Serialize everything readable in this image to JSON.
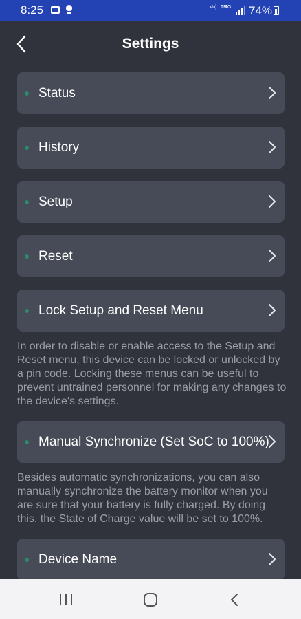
{
  "status_bar": {
    "time": "8:25",
    "volte": "Vo) LTE",
    "network": "4G",
    "battery_percent": "74%"
  },
  "header": {
    "title": "Settings"
  },
  "menu": {
    "items": [
      {
        "label": "Status"
      },
      {
        "label": "History"
      },
      {
        "label": "Setup"
      },
      {
        "label": "Reset"
      },
      {
        "label": "Lock Setup and Reset Menu"
      },
      {
        "label": "Manual Synchronize (Set SoC to 100%)"
      },
      {
        "label": "Device Name"
      }
    ]
  },
  "descriptions": {
    "lock": "In order to disable or enable access to the Setup and Reset menu, this device can be locked or unlocked by a pin code. Locking these menus can be useful to prevent untrained personnel for making any changes to the device's settings.",
    "sync": "Besides automatic synchronizations, you can also manually synchronize the battery monitor when you are sure that your battery is fully charged. By doing this, the State of Charge value will be set to 100%."
  },
  "colors": {
    "background": "#30323c",
    "card": "#474a57",
    "status_bar": "#2342b4",
    "indicator_dot": "#2c8a68",
    "description_text": "#9b9da6"
  },
  "icons": [
    "gallery-icon",
    "bulb-icon",
    "signal-icon",
    "battery-icon",
    "back-arrow-icon",
    "chevron-right-icon",
    "recent-apps-icon",
    "home-icon",
    "nav-back-icon"
  ]
}
